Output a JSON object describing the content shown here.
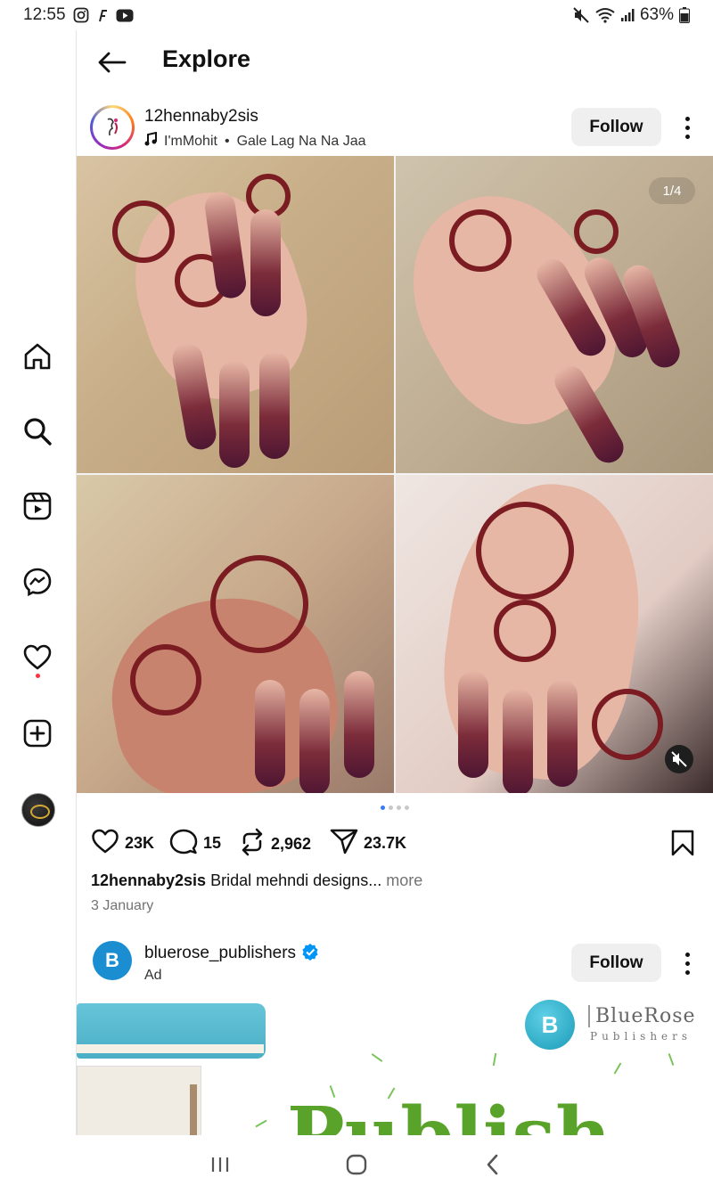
{
  "status_bar": {
    "time": "12:55",
    "battery": "63%"
  },
  "header": {
    "title": "Explore"
  },
  "post1": {
    "username": "12hennaby2sis",
    "audio_artist": "I'mMohit",
    "audio_separator": "•",
    "audio_track": "Gale Lag Na Na Jaa",
    "follow_label": "Follow",
    "image_counter": "1/4",
    "likes": "23K",
    "comments": "15",
    "reposts": "2,962",
    "shares": "23.7K",
    "caption_user": "12hennaby2sis",
    "caption_text": "Bridal mehndi designs...",
    "caption_more": "more",
    "date": "3 January",
    "carousel_total": 4,
    "carousel_active": 1
  },
  "post2": {
    "username": "bluerose_publishers",
    "subtitle": "Ad",
    "follow_label": "Follow",
    "avatar_letter": "B",
    "brand_name": "BlueRose",
    "brand_sub": "Publishers",
    "headline": "Publish"
  },
  "nav": {
    "items": [
      "home-icon",
      "search-icon",
      "reels-icon",
      "messenger-icon",
      "heart-icon",
      "create-icon",
      "profile-avatar"
    ]
  },
  "colors": {
    "accent_blue": "#3a7bf6",
    "notif_red": "#ff3040",
    "henna": "#7a1c22",
    "verified_blue": "#0095f6"
  }
}
